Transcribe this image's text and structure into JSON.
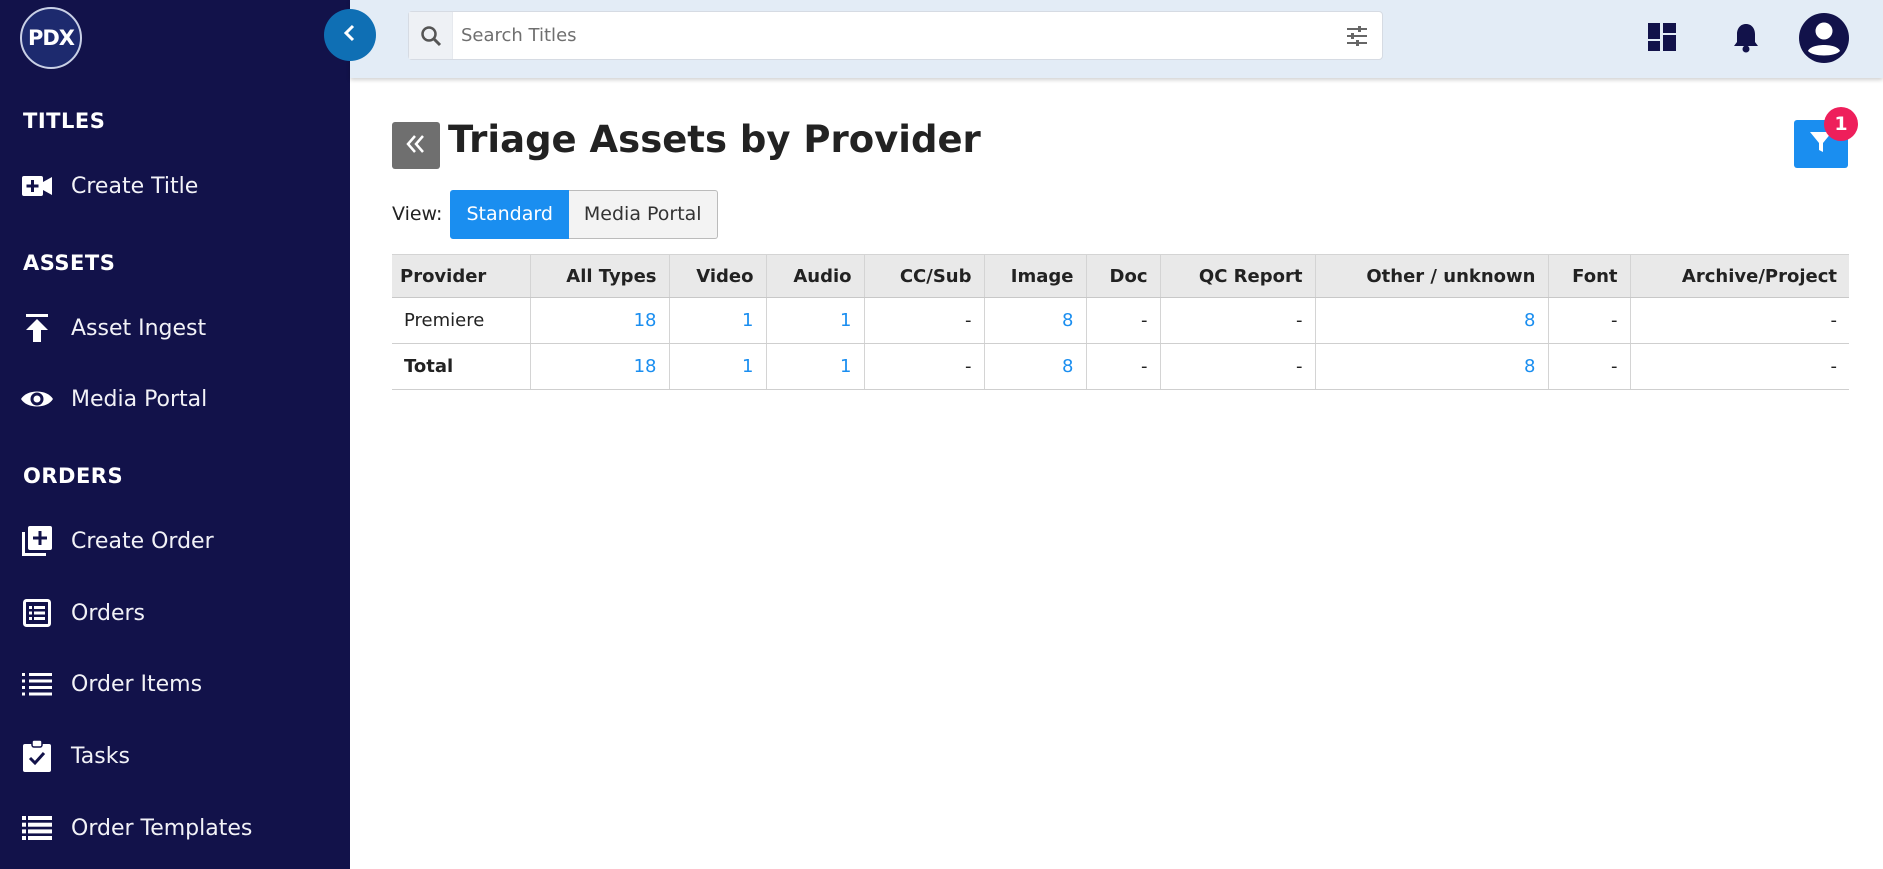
{
  "app": {
    "logo_text": "PDX"
  },
  "sidebar": {
    "sections": [
      {
        "title": "TITLES",
        "items": [
          {
            "label": "Create Title",
            "icon": "video-plus-icon"
          }
        ]
      },
      {
        "title": "ASSETS",
        "items": [
          {
            "label": "Asset Ingest",
            "icon": "upload-icon"
          },
          {
            "label": "Media Portal",
            "icon": "eye-icon"
          }
        ]
      },
      {
        "title": "ORDERS",
        "items": [
          {
            "label": "Create Order",
            "icon": "add-box-icon"
          },
          {
            "label": "Orders",
            "icon": "list-box-icon"
          },
          {
            "label": "Order Items",
            "icon": "list-icon"
          },
          {
            "label": "Tasks",
            "icon": "clipboard-check-icon"
          },
          {
            "label": "Order Templates",
            "icon": "table-rows-icon"
          }
        ]
      }
    ]
  },
  "header": {
    "search_placeholder": "Search Titles",
    "icons": [
      "dashboard-icon",
      "bell-icon",
      "account-icon"
    ]
  },
  "page": {
    "title": "Triage Assets by Provider",
    "filter_badge": "1",
    "view_label": "View:",
    "views": [
      {
        "label": "Standard",
        "active": true
      },
      {
        "label": "Media Portal",
        "active": false
      }
    ]
  },
  "table": {
    "columns": [
      "Provider",
      "All Types",
      "Video",
      "Audio",
      "CC/Sub",
      "Image",
      "Doc",
      "QC Report",
      "Other / unknown",
      "Font",
      "Archive/Project"
    ],
    "rows": [
      {
        "cells": [
          "Premiere",
          "18",
          "1",
          "1",
          "-",
          "8",
          "-",
          "-",
          "8",
          "-",
          "-"
        ]
      },
      {
        "cells": [
          "Total",
          "18",
          "1",
          "1",
          "-",
          "8",
          "-",
          "-",
          "8",
          "-",
          "-"
        ]
      }
    ]
  },
  "colors": {
    "sidebar_bg": "#12124a",
    "accent": "#1a8ef0",
    "badge": "#ee1f5b",
    "header_bg": "#e3ecf6"
  }
}
